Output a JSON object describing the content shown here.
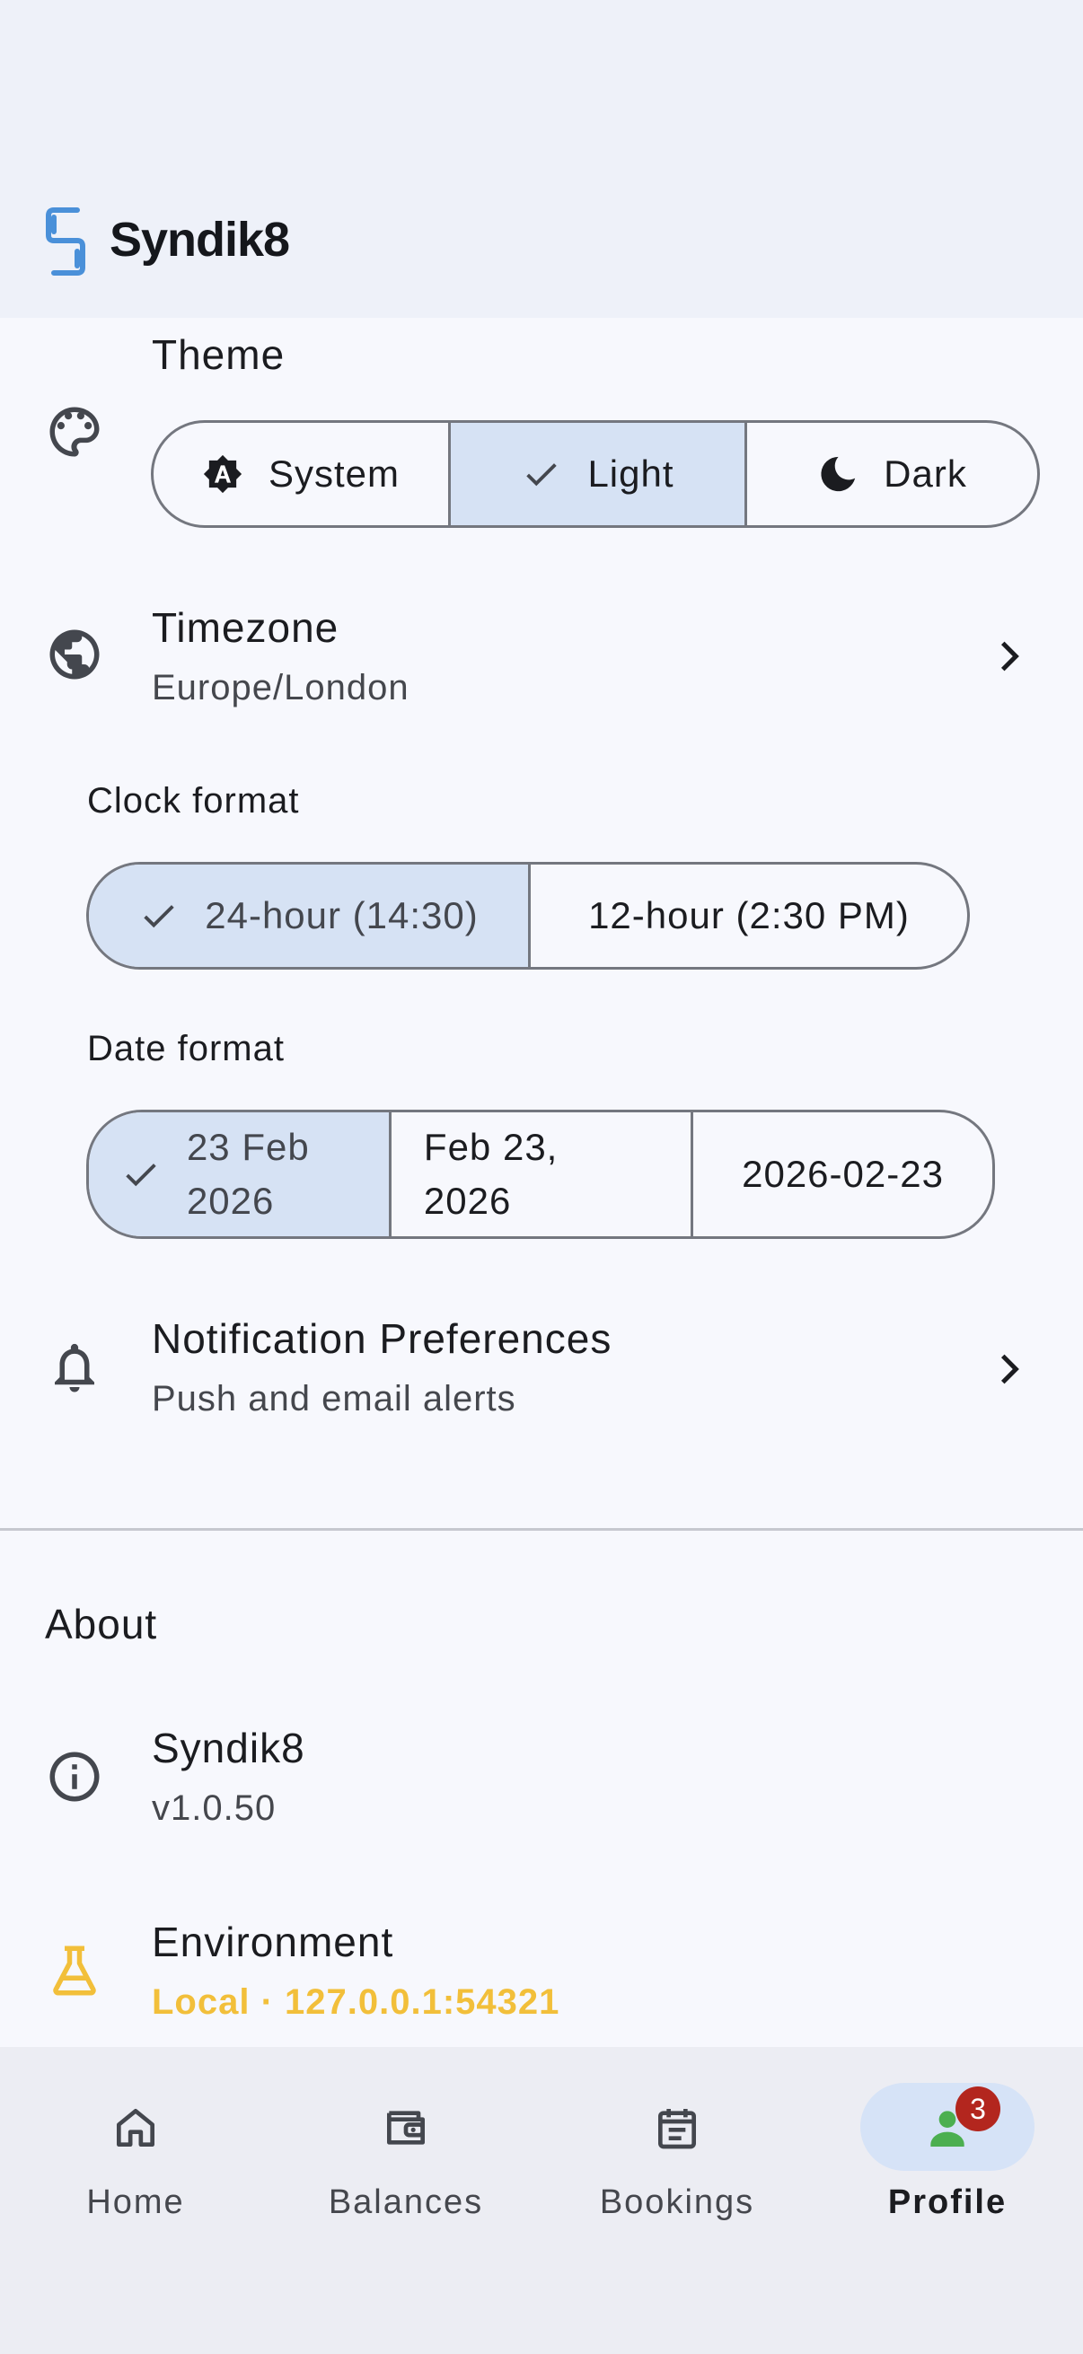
{
  "app": {
    "name": "Syndik8",
    "brand_color": "#4a90d9"
  },
  "theme": {
    "label": "Theme",
    "icon": "palette-icon",
    "options": [
      {
        "label": "System",
        "icon": "auto-brightness-icon",
        "selected": false
      },
      {
        "label": "Light",
        "icon": "check-icon",
        "selected": true
      },
      {
        "label": "Dark",
        "icon": "moon-icon",
        "selected": false
      }
    ]
  },
  "timezone": {
    "label": "Timezone",
    "value": "Europe/London",
    "icon": "globe-icon"
  },
  "clock_format": {
    "label": "Clock format",
    "options": [
      {
        "label": "24-hour (14:30)",
        "selected": true
      },
      {
        "label": "12-hour (2:30 PM)",
        "selected": false
      }
    ]
  },
  "date_format": {
    "label": "Date format",
    "options": [
      {
        "label": "23 Feb 2026",
        "selected": true
      },
      {
        "label": "Feb 23, 2026",
        "selected": false
      },
      {
        "label": "2026-02-23",
        "selected": false
      }
    ]
  },
  "notifications": {
    "label": "Notification Preferences",
    "subtitle": "Push and email alerts",
    "icon": "bell-icon"
  },
  "about": {
    "header": "About",
    "app_info": {
      "label": "Syndik8",
      "version": "v1.0.50",
      "icon": "info-icon"
    },
    "environment": {
      "label": "Environment",
      "value": "Local · 127.0.0.1:54321",
      "icon": "flask-icon",
      "color": "#f2bf3a"
    }
  },
  "nav": {
    "items": [
      {
        "label": "Home",
        "icon": "home-icon",
        "active": false
      },
      {
        "label": "Balances",
        "icon": "wallet-icon",
        "active": false
      },
      {
        "label": "Bookings",
        "icon": "calendar-icon",
        "active": false
      },
      {
        "label": "Profile",
        "icon": "person-icon",
        "active": true,
        "badge": "3"
      }
    ]
  },
  "colors": {
    "selected_segment": "#d6e2f4",
    "badge": "#b3261e",
    "profile_icon": "#4caf50"
  }
}
